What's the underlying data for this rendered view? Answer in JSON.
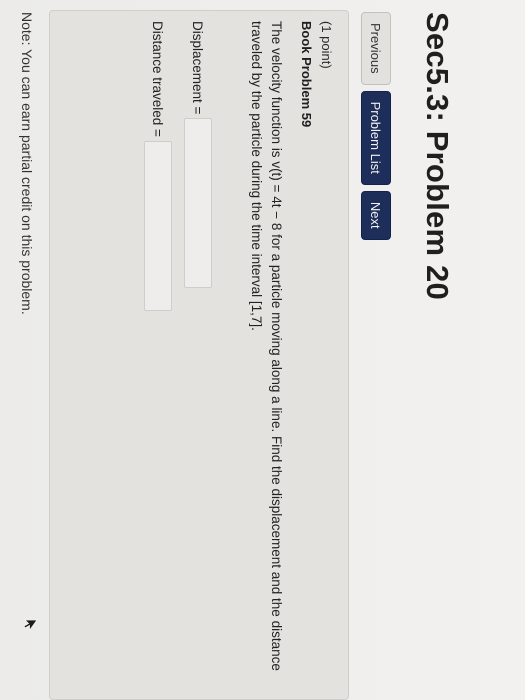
{
  "page": {
    "title": "Sec5.3: Problem 20"
  },
  "nav": {
    "previous_label": "Previous",
    "problem_list_label": "Problem List",
    "next_label": "Next"
  },
  "problem": {
    "points": "(1 point)",
    "book_problem": "Book Problem 59",
    "statement": "The velocity function is v(t) = 4t − 8 for a particle moving along a line. Find the displacement and the distance traveled by the particle during the time interval [1,7].",
    "displacement_label": "Displacement =",
    "displacement_value": "",
    "distance_label": "Distance traveled =",
    "distance_value": ""
  },
  "footer": {
    "note": "Note: You can earn partial credit on this problem."
  },
  "icons": {
    "cursor": "mouse-pointer-icon"
  },
  "colors": {
    "nav_dark_button": "#1e2e5a",
    "background": "#f3f1ef"
  }
}
